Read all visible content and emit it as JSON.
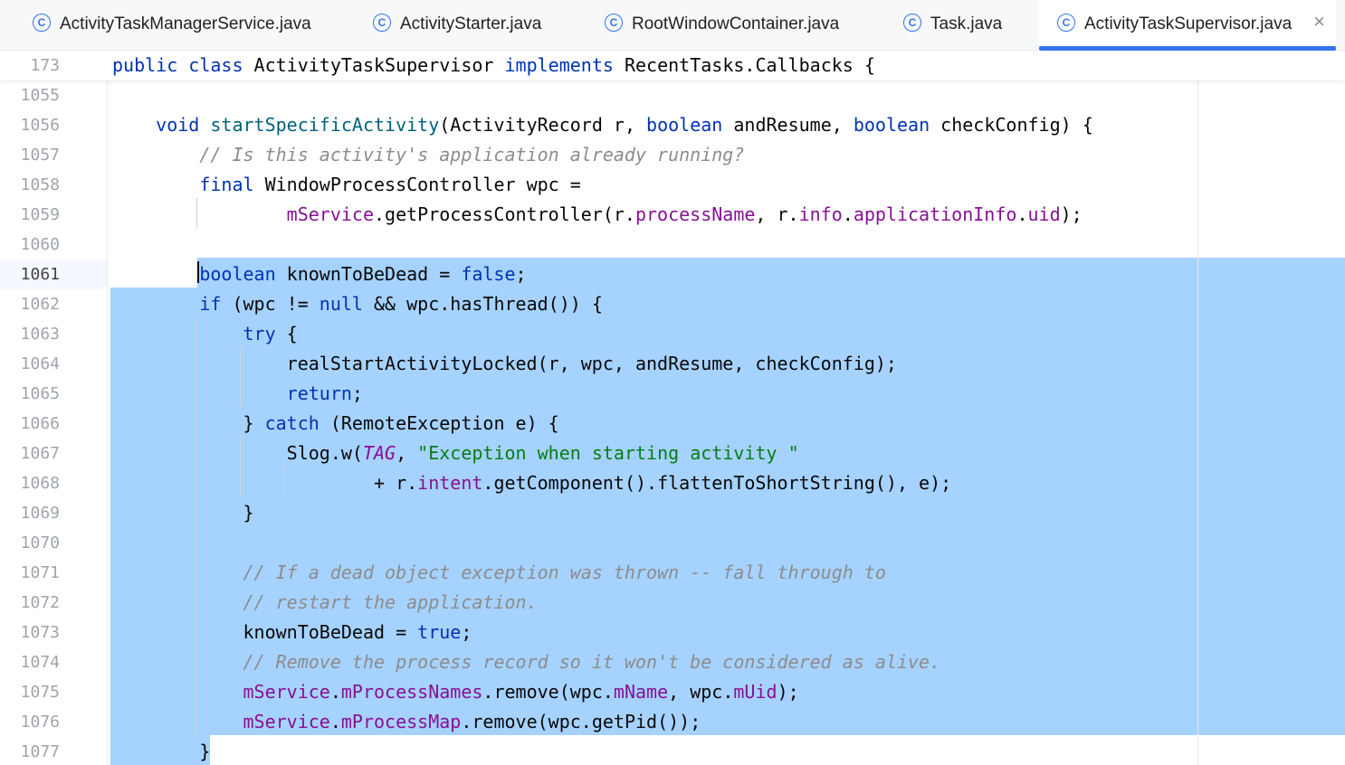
{
  "tabs": [
    {
      "label": "ActivityTaskManagerService.java",
      "active": false
    },
    {
      "label": "ActivityStarter.java",
      "active": false
    },
    {
      "label": "RootWindowContainer.java",
      "active": false
    },
    {
      "label": "Task.java",
      "active": false
    },
    {
      "label": "ActivityTaskSupervisor.java",
      "active": true
    }
  ],
  "tab_icon": "java-class-icon",
  "sticky": {
    "line": "173",
    "code": "public class ActivityTaskSupervisor implements RecentTasks.Callbacks {"
  },
  "current_line": "1061",
  "lines": [
    {
      "n": "1055",
      "code": ""
    },
    {
      "n": "1056",
      "code": "    void startSpecificActivity(ActivityRecord r, boolean andResume, boolean checkConfig) {"
    },
    {
      "n": "1057",
      "code": "        // Is this activity's application already running?"
    },
    {
      "n": "1058",
      "code": "        final WindowProcessController wpc ="
    },
    {
      "n": "1059",
      "code": "                mService.getProcessController(r.processName, r.info.applicationInfo.uid);"
    },
    {
      "n": "1060",
      "code": ""
    },
    {
      "n": "1061",
      "code": "        boolean knownToBeDead = false;"
    },
    {
      "n": "1062",
      "code": "        if (wpc != null && wpc.hasThread()) {"
    },
    {
      "n": "1063",
      "code": "            try {"
    },
    {
      "n": "1064",
      "code": "                realStartActivityLocked(r, wpc, andResume, checkConfig);"
    },
    {
      "n": "1065",
      "code": "                return;"
    },
    {
      "n": "1066",
      "code": "            } catch (RemoteException e) {"
    },
    {
      "n": "1067",
      "code": "                Slog.w(TAG, \"Exception when starting activity \""
    },
    {
      "n": "1068",
      "code": "                        + r.intent.getComponent().flattenToShortString(), e);"
    },
    {
      "n": "1069",
      "code": "            }"
    },
    {
      "n": "1070",
      "code": ""
    },
    {
      "n": "1071",
      "code": "            // If a dead object exception was thrown -- fall through to"
    },
    {
      "n": "1072",
      "code": "            // restart the application."
    },
    {
      "n": "1073",
      "code": "            knownToBeDead = true;"
    },
    {
      "n": "1074",
      "code": "            // Remove the process record so it won't be considered as alive."
    },
    {
      "n": "1075",
      "code": "            mService.mProcessNames.remove(wpc.mName, wpc.mUid);"
    },
    {
      "n": "1076",
      "code": "            mService.mProcessMap.remove(wpc.getPid());"
    },
    {
      "n": "1077",
      "code": "        }"
    }
  ],
  "colors": {
    "keyword": "#0033b3",
    "method_decl": "#00627a",
    "field": "#871094",
    "comment": "#8c8c8c",
    "string": "#067d17",
    "selection": "#a6d2ff",
    "tab_accent": "#3574f0"
  }
}
